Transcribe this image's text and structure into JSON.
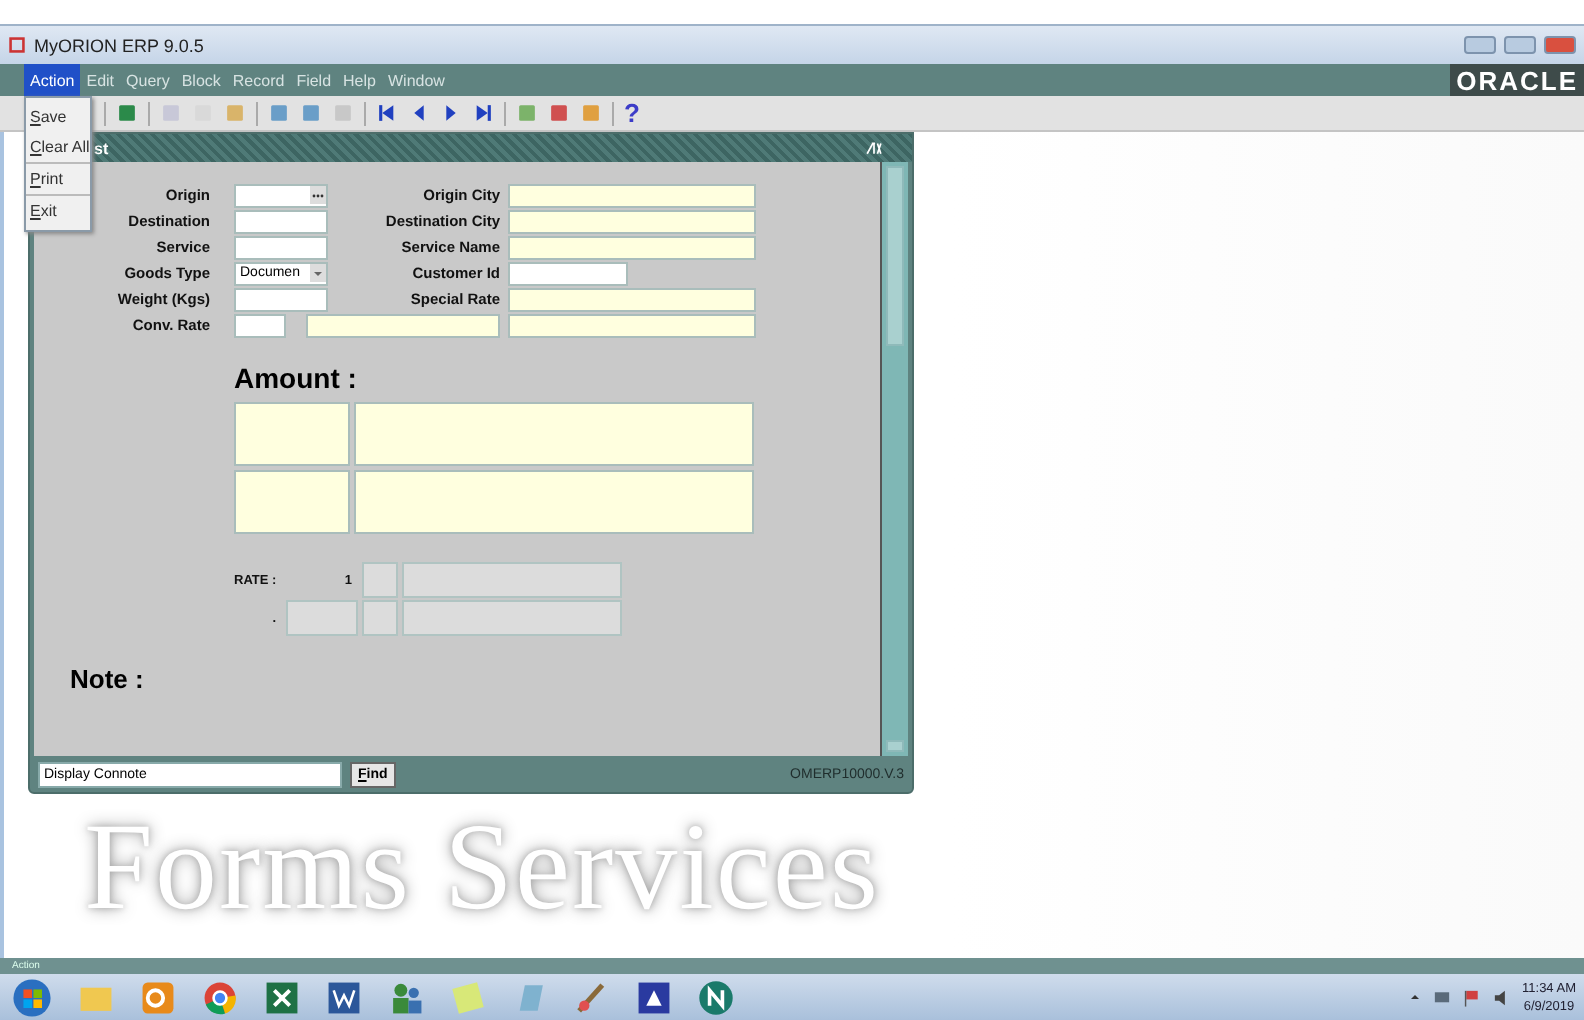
{
  "window": {
    "title": "MyORION ERP 9.0.5",
    "brand": "ORACLE"
  },
  "menu_bar": [
    {
      "label": "Action",
      "selected": true
    },
    {
      "label": "Edit",
      "selected": false
    },
    {
      "label": "Query",
      "selected": false
    },
    {
      "label": "Block",
      "selected": false
    },
    {
      "label": "Record",
      "selected": false
    },
    {
      "label": "Field",
      "selected": false
    },
    {
      "label": "Help",
      "selected": false
    },
    {
      "label": "Window",
      "selected": false
    }
  ],
  "action_menu": [
    {
      "label": "Save"
    },
    {
      "label": "Clear All"
    },
    {
      "label": "Print"
    },
    {
      "label": "Exit"
    }
  ],
  "toolbar": {
    "help_glyph": "?"
  },
  "form": {
    "title": "st",
    "rows": [
      {
        "left": {
          "label": "Origin",
          "kind": "lov"
        },
        "right": {
          "label": "Origin City",
          "kind": "display"
        }
      },
      {
        "left": {
          "label": "Destination",
          "kind": "text"
        },
        "right": {
          "label": "Destination City",
          "kind": "display"
        }
      },
      {
        "left": {
          "label": "Service",
          "kind": "text"
        },
        "right": {
          "label": "Service Name",
          "kind": "display"
        }
      },
      {
        "left": {
          "label": "Goods Type",
          "kind": "select",
          "value": "Documen"
        },
        "right": {
          "label": "Customer Id",
          "kind": "short"
        }
      },
      {
        "left": {
          "label": "Weight (Kgs)",
          "kind": "text"
        },
        "right": {
          "label": "Special Rate",
          "kind": "display"
        }
      },
      {
        "left": {
          "label": "Conv. Rate",
          "kind": "pair"
        },
        "right": {
          "kind": "display"
        }
      }
    ],
    "amount_label": "Amount :",
    "rate": {
      "label": "RATE :",
      "number": "1",
      "dot": "."
    },
    "note_label": "Note :",
    "search_value": "Display Connote",
    "find_button": "Find",
    "version": "OMERP10000.V.3"
  },
  "backdrop_logo": "Forms Services",
  "status_bar": "Action",
  "clock": {
    "time": "11:34 AM",
    "date": "6/9/2019"
  }
}
